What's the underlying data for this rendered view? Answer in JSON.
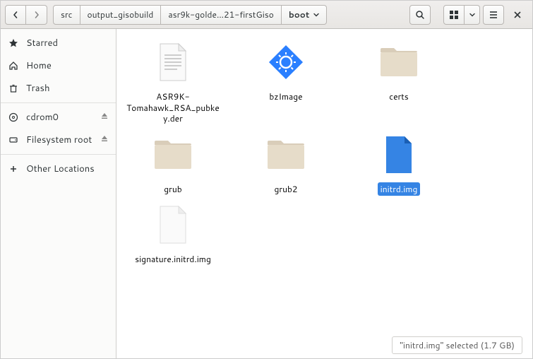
{
  "toolbar": {
    "path": [
      "src",
      "output_gisobuild",
      "asr9k-golde...21-firstGiso",
      "boot"
    ],
    "current_index": 3
  },
  "sidebar": {
    "starred": "Starred",
    "home": "Home",
    "trash": "Trash",
    "cdrom": "cdrom0",
    "fsroot": "Filesystem root",
    "other": "Other Locations"
  },
  "files": {
    "items": [
      {
        "name": "ASR9K-Tomahawk_RSA_pubkey.der",
        "type": "text-file",
        "selected": false
      },
      {
        "name": "bzImage",
        "type": "binary-file",
        "selected": false
      },
      {
        "name": "certs",
        "type": "folder",
        "selected": false
      },
      {
        "name": "grub",
        "type": "folder",
        "selected": false
      },
      {
        "name": "grub2",
        "type": "folder",
        "selected": false
      },
      {
        "name": "initrd.img",
        "type": "selected-file",
        "selected": true
      },
      {
        "name": "signature.initrd.img",
        "type": "blank-file",
        "selected": false
      }
    ]
  },
  "status": "\"initrd.img\" selected (1.7 GB)"
}
